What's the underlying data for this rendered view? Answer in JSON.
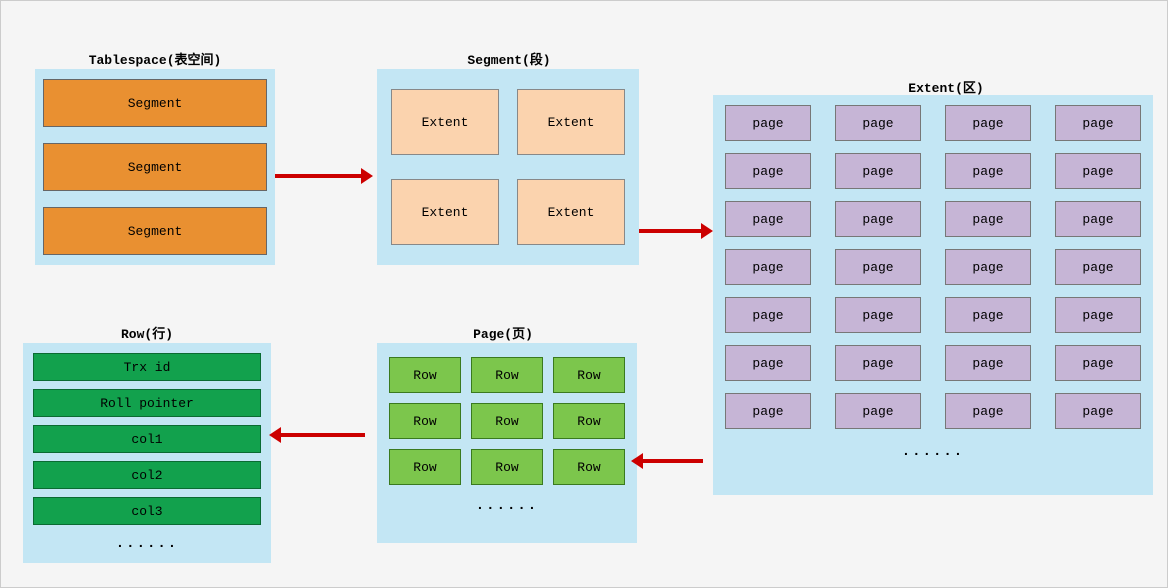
{
  "tablespace": {
    "title": "Tablespace(表空间)",
    "items": [
      "Segment",
      "Segment",
      "Segment"
    ]
  },
  "segment": {
    "title": "Segment(段)",
    "items": [
      "Extent",
      "Extent",
      "Extent",
      "Extent"
    ]
  },
  "extent": {
    "title": "Extent(区)",
    "page_label": "page",
    "rows": 7,
    "cols": 4,
    "more": "······"
  },
  "page": {
    "title": "Page(页)",
    "row_label": "Row",
    "rows": 3,
    "cols": 3,
    "more": "······"
  },
  "row": {
    "title": "Row(行)",
    "fields": [
      "Trx id",
      "Roll pointer",
      "col1",
      "col2",
      "col3"
    ],
    "more": "······"
  }
}
